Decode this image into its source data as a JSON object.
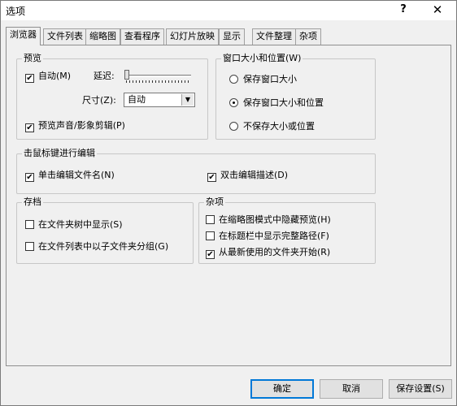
{
  "window": {
    "title": "选项",
    "help_label": "?",
    "close_label": "✕"
  },
  "tabs": [
    {
      "label": "浏览器",
      "active": true
    },
    {
      "label": "文件列表",
      "active": false
    },
    {
      "label": "缩略图",
      "active": false
    },
    {
      "label": "查看程序",
      "active": false
    },
    {
      "label": "幻灯片放映",
      "active": false
    },
    {
      "label": "显示",
      "active": false
    },
    {
      "label": "文件整理",
      "active": false
    },
    {
      "label": "杂项",
      "active": false
    }
  ],
  "preview": {
    "title": "预览",
    "auto_label": "自动(M)",
    "auto_checked": true,
    "delay_label": "延迟:",
    "delay_level": 0,
    "size_label": "尺寸(Z):",
    "size_value": "自动",
    "sound_label": "预览声音/影象剪辑(P)",
    "sound_checked": true
  },
  "window_size": {
    "title": "窗口大小和位置(W)",
    "options": [
      {
        "label": "保存窗口大小",
        "selected": false
      },
      {
        "label": "保存窗口大小和位置",
        "selected": true
      },
      {
        "label": "不保存大小或位置",
        "selected": false
      }
    ]
  },
  "click_edit": {
    "title": "击鼠标键进行编辑",
    "single_label": "单击编辑文件名(N)",
    "single_checked": true,
    "double_label": "双击编辑描述(D)",
    "double_checked": true
  },
  "archive": {
    "title": "存档",
    "items": [
      {
        "label": "在文件夹树中显示(S)",
        "checked": false
      },
      {
        "label": "在文件列表中以子文件夹分组(G)",
        "checked": false
      }
    ]
  },
  "misc": {
    "title": "杂项",
    "items": [
      {
        "label": "在缩略图模式中隐藏预览(H)",
        "checked": false
      },
      {
        "label": "在标题栏中显示完整路径(F)",
        "checked": false
      },
      {
        "label": "从最新使用的文件夹开始(R)",
        "checked": true
      }
    ]
  },
  "buttons": {
    "ok": "确定",
    "cancel": "取消",
    "save": "保存设置(S)"
  },
  "check_mark": "✔"
}
